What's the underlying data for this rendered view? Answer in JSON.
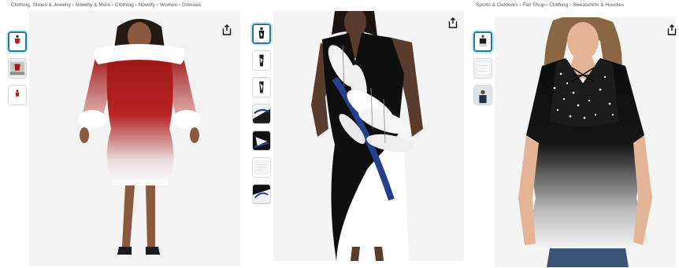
{
  "products": [
    {
      "breadcrumb": "Clothing, Shoes & Jewelry › Novelty & More › Clothing › Novelty › Women › Dresses",
      "thumbnail_count": 3,
      "share_icon": "share-icon"
    },
    {
      "breadcrumb": "",
      "thumbnail_count": 7,
      "share_icon": "share-icon"
    },
    {
      "breadcrumb": "Sports & Outdoors › Fan Shop › Clothing › Sweatshirts & Hoodies",
      "thumbnail_count": 3,
      "share_icon": "share-icon"
    }
  ],
  "colors": {
    "active_thumb_border": "#2b7a8c",
    "breadcrumb_text": "#565959"
  }
}
